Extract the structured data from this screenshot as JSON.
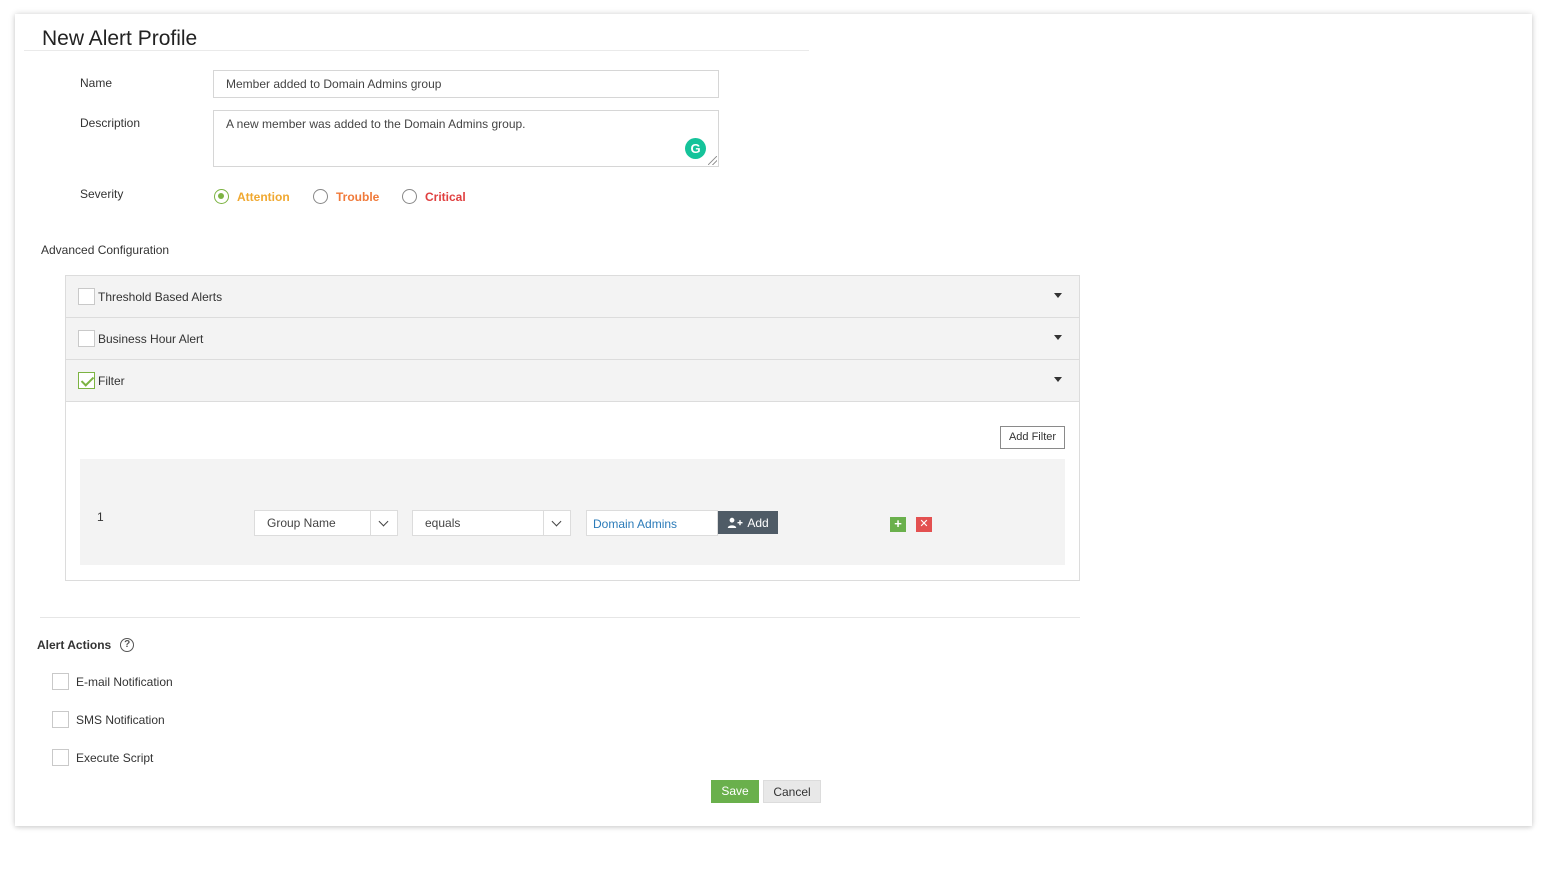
{
  "page": {
    "title": "New Alert Profile"
  },
  "form": {
    "name_label": "Name",
    "name_value": "Member added to Domain Admins group",
    "description_label": "Description",
    "description_value": "A new member was added to the Domain Admins group.",
    "severity_label": "Severity",
    "severity_options": [
      {
        "label": "Attention",
        "color": "#f0a830",
        "selected": true
      },
      {
        "label": "Trouble",
        "color": "#f07a3a",
        "selected": false
      },
      {
        "label": "Critical",
        "color": "#e04040",
        "selected": false
      }
    ]
  },
  "advanced": {
    "title": "Advanced Configuration",
    "sections": [
      {
        "label": "Threshold Based Alerts",
        "checked": false
      },
      {
        "label": "Business Hour Alert",
        "checked": false
      },
      {
        "label": "Filter",
        "checked": true
      }
    ],
    "add_filter_label": "Add Filter",
    "filter_row": {
      "index": "1",
      "field": "Group Name",
      "operator": "equals",
      "value": "Domain Admins",
      "add_label": "Add"
    }
  },
  "alert_actions": {
    "title": "Alert Actions",
    "items": [
      {
        "label": "E-mail Notification",
        "checked": false
      },
      {
        "label": "SMS Notification",
        "checked": false
      },
      {
        "label": "Execute Script",
        "checked": false
      }
    ]
  },
  "buttons": {
    "save": "Save",
    "cancel": "Cancel"
  },
  "colors": {
    "accent_green": "#6ab04c",
    "delete_red": "#e35050",
    "link_blue": "#2b7bb9",
    "grammarly": "#15c39a"
  }
}
